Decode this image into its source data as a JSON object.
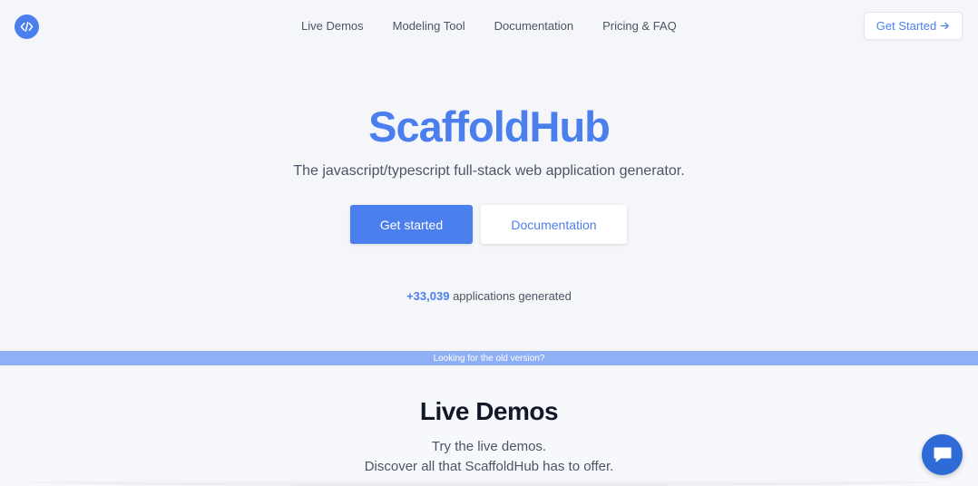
{
  "header": {
    "logo_icon": "code-icon",
    "nav": [
      {
        "label": "Live Demos"
      },
      {
        "label": "Modeling Tool"
      },
      {
        "label": "Documentation"
      },
      {
        "label": "Pricing & FAQ"
      }
    ],
    "cta_label": "Get Started",
    "cta_icon": "arrow-right-icon"
  },
  "hero": {
    "title": "ScaffoldHub",
    "subtitle": "The javascript/typescript full-stack web application generator.",
    "primary_button": "Get started",
    "secondary_button": "Documentation",
    "stats_count": "+33,039",
    "stats_label": " applications generated"
  },
  "banner": {
    "text": "Looking for the old version?"
  },
  "live_demos": {
    "title": "Live Demos",
    "line1": "Try the live demos.",
    "line2": "Discover all that ScaffoldHub has to offer."
  },
  "chat": {
    "icon": "chat-bubble-icon"
  },
  "colors": {
    "accent": "#4c7fee",
    "banner": "#8fb0f5",
    "chat": "#2f6bd6",
    "background": "#f4f6fa"
  }
}
